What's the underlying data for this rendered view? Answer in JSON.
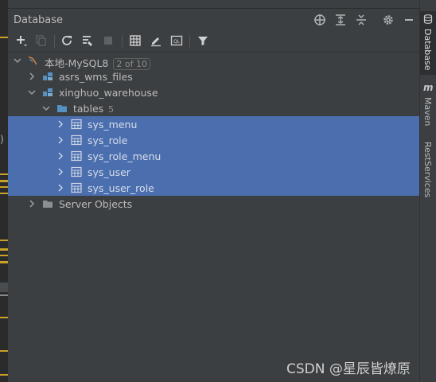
{
  "panel": {
    "title": "Database"
  },
  "header_icons": [
    "crosshair-icon",
    "expand-all-icon",
    "collapse-all-icon",
    "gear-icon",
    "minimize-icon"
  ],
  "toolbar_icons": [
    "add-icon",
    "copy-icon",
    "refresh-icon",
    "schema-sync-icon",
    "stop-icon",
    "table-icon",
    "edit-icon",
    "sql-console-icon",
    "filter-icon"
  ],
  "tree": {
    "root": {
      "label": "本地-MySQL8",
      "badge": "2 of 10"
    },
    "db1": {
      "label": "asrs_wms_files"
    },
    "db2": {
      "label": "xinghuo_warehouse"
    },
    "tables": {
      "label": "tables",
      "count": "5"
    },
    "items": [
      {
        "label": "sys_menu"
      },
      {
        "label": "sys_role"
      },
      {
        "label": "sys_role_menu"
      },
      {
        "label": "sys_user"
      },
      {
        "label": "sys_user_role"
      }
    ],
    "server_objects": {
      "label": "Server Objects"
    }
  },
  "right_tabs": {
    "database": "Database",
    "maven": "Maven",
    "rest": "RestServices"
  },
  "watermark": "CSDN @星辰皆燎原",
  "colors": {
    "selection": "#4b6eaf",
    "panel_bg": "#3c3f41",
    "folder": "#5591c4",
    "gutter_mark": "#c9a227"
  }
}
